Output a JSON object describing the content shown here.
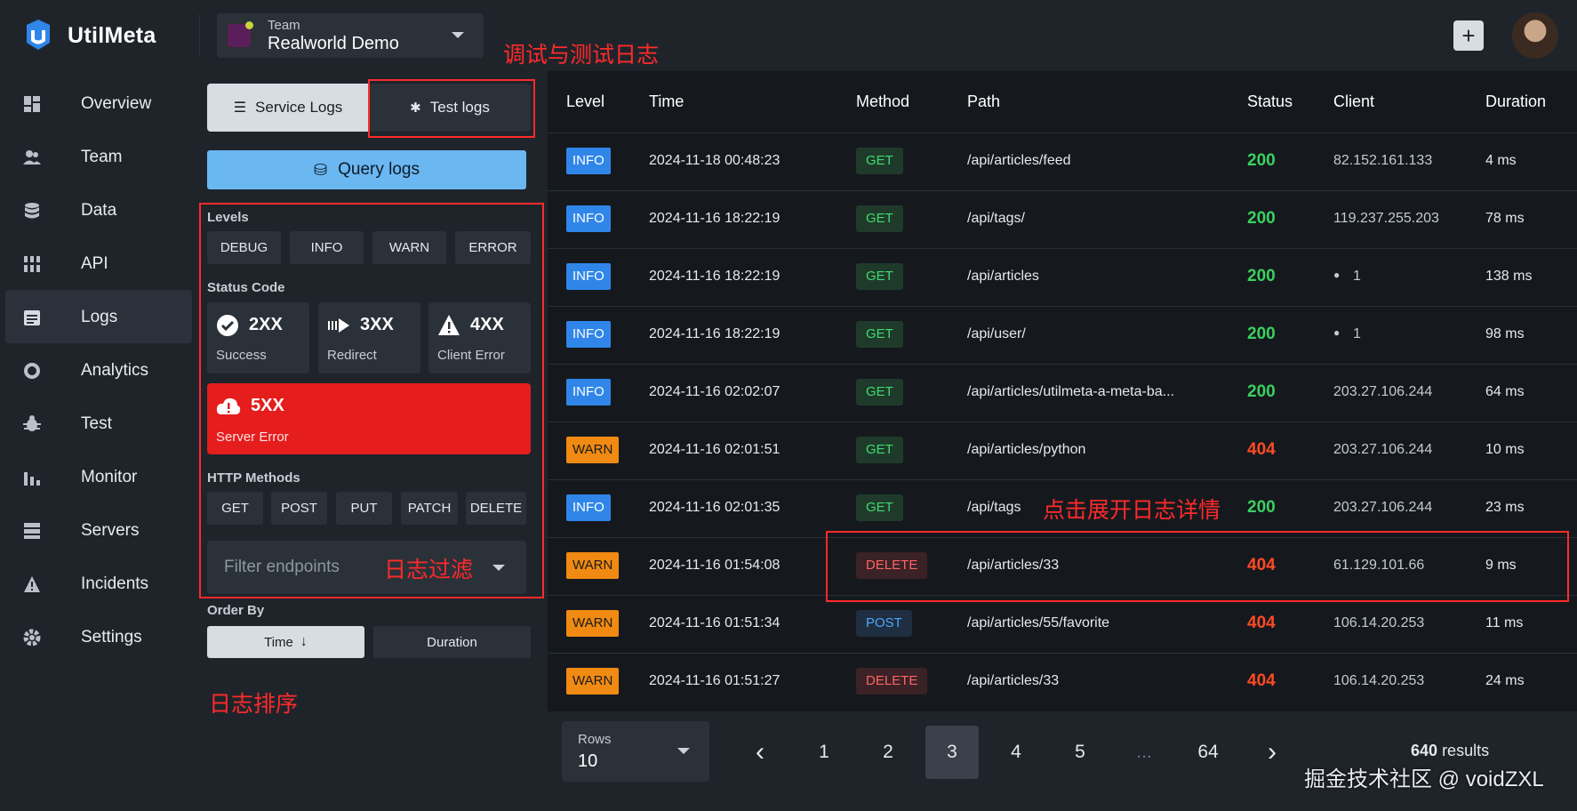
{
  "app": {
    "name": "UtilMeta"
  },
  "team": {
    "label": "Team",
    "name": "Realworld Demo"
  },
  "header": {
    "add_label": "+"
  },
  "annotations": {
    "test_logs": "调试与测试日志",
    "expand": "点击展开日志详情",
    "filter": "日志过滤",
    "sort": "日志排序"
  },
  "sidebar": {
    "items": [
      {
        "label": "Overview",
        "icon": "dashboard-icon"
      },
      {
        "label": "Team",
        "icon": "people-icon"
      },
      {
        "label": "Data",
        "icon": "database-icon"
      },
      {
        "label": "API",
        "icon": "api-icon"
      },
      {
        "label": "Logs",
        "icon": "logs-icon"
      },
      {
        "label": "Analytics",
        "icon": "analytics-icon"
      },
      {
        "label": "Test",
        "icon": "bug-icon"
      },
      {
        "label": "Monitor",
        "icon": "bar-chart-icon"
      },
      {
        "label": "Servers",
        "icon": "server-icon"
      },
      {
        "label": "Incidents",
        "icon": "warning-icon"
      },
      {
        "label": "Settings",
        "icon": "gear-icon"
      }
    ],
    "active": "Logs"
  },
  "panel": {
    "service_logs": "Service Logs",
    "test_logs": "Test logs",
    "query": "Query logs",
    "levels_title": "Levels",
    "levels": [
      "DEBUG",
      "INFO",
      "WARN",
      "ERROR"
    ],
    "status_title": "Status Code",
    "status": [
      {
        "code": "2XX",
        "label": "Success"
      },
      {
        "code": "3XX",
        "label": "Redirect"
      },
      {
        "code": "4XX",
        "label": "Client Error"
      },
      {
        "code": "5XX",
        "label": "Server Error"
      }
    ],
    "methods_title": "HTTP Methods",
    "methods": [
      "GET",
      "POST",
      "PUT",
      "PATCH",
      "DELETE"
    ],
    "filter_placeholder": "Filter endpoints",
    "order_title": "Order By",
    "order": [
      "Time",
      "Duration"
    ]
  },
  "table": {
    "headers": [
      "Level",
      "Time",
      "Method",
      "Path",
      "Status",
      "Client",
      "Duration"
    ],
    "rows": [
      {
        "level": "INFO",
        "time": "2024-11-18 00:48:23",
        "method": "GET",
        "path": "/api/articles/feed",
        "status": "200",
        "client": "82.152.161.133",
        "duration": "4 ms"
      },
      {
        "level": "INFO",
        "time": "2024-11-16 18:22:19",
        "method": "GET",
        "path": "/api/tags/",
        "status": "200",
        "client": "119.237.255.203",
        "duration": "78 ms"
      },
      {
        "level": "INFO",
        "time": "2024-11-16 18:22:19",
        "method": "GET",
        "path": "/api/articles",
        "status": "200",
        "client": "1",
        "duration": "138 ms"
      },
      {
        "level": "INFO",
        "time": "2024-11-16 18:22:19",
        "method": "GET",
        "path": "/api/user/",
        "status": "200",
        "client": "1",
        "duration": "98 ms"
      },
      {
        "level": "INFO",
        "time": "2024-11-16 02:02:07",
        "method": "GET",
        "path": "/api/articles/utilmeta-a-meta-ba...",
        "status": "200",
        "client": "203.27.106.244",
        "duration": "64 ms"
      },
      {
        "level": "WARN",
        "time": "2024-11-16 02:01:51",
        "method": "GET",
        "path": "/api/articles/python",
        "status": "404",
        "client": "203.27.106.244",
        "duration": "10 ms"
      },
      {
        "level": "INFO",
        "time": "2024-11-16 02:01:35",
        "method": "GET",
        "path": "/api/tags",
        "status": "200",
        "client": "203.27.106.244",
        "duration": "23 ms"
      },
      {
        "level": "WARN",
        "time": "2024-11-16 01:54:08",
        "method": "DELETE",
        "path": "/api/articles/33",
        "status": "404",
        "client": "61.129.101.66",
        "duration": "9 ms"
      },
      {
        "level": "WARN",
        "time": "2024-11-16 01:51:34",
        "method": "POST",
        "path": "/api/articles/55/favorite",
        "status": "404",
        "client": "106.14.20.253",
        "duration": "11 ms"
      },
      {
        "level": "WARN",
        "time": "2024-11-16 01:51:27",
        "method": "DELETE",
        "path": "/api/articles/33",
        "status": "404",
        "client": "106.14.20.253",
        "duration": "24 ms"
      }
    ]
  },
  "pagination": {
    "rows_label": "Rows",
    "rows_value": "10",
    "prev": "‹",
    "next": "›",
    "pages": [
      "1",
      "2",
      "3",
      "4",
      "5",
      "...",
      "64"
    ],
    "current": "3",
    "results_count": "640",
    "results_label": "results"
  },
  "watermark": "掘金技术社区 @ voidZXL",
  "colors": {
    "info": "#2f86e8",
    "warn": "#f08a12",
    "ok": "#3bd05f",
    "error": "#ff4a23",
    "accent": "#6ab7f2",
    "danger": "#e51d1d"
  }
}
